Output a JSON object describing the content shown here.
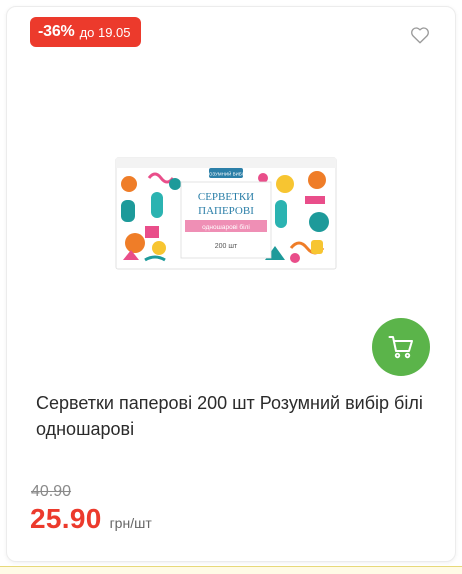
{
  "badge": {
    "discount": "-36%",
    "valid_until": "до 19.05",
    "color": "#ec3a2c"
  },
  "wishlist": {
    "icon": "heart-outline-icon"
  },
  "product": {
    "image_text": {
      "line1": "СЕРВЕТКИ",
      "line2": "ПАПЕРОВІ",
      "ribbon": "одношарові білі",
      "count": "200 шт",
      "brand": "РОЗУМНИЙ ВИБІР"
    },
    "title": "Серветки паперові 200 шт Розумний вибір білі одношарові"
  },
  "cart": {
    "icon": "shopping-cart-icon",
    "color": "#5bb44a"
  },
  "price": {
    "old": "40.90",
    "current": "25.90",
    "unit": "грн/шт"
  }
}
